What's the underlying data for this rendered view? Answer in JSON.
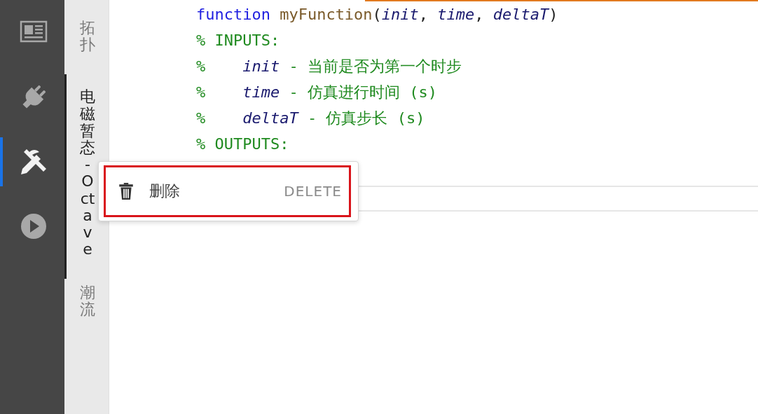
{
  "rail": {
    "items": [
      {
        "kind": "layout",
        "selected": false
      },
      {
        "kind": "plug",
        "selected": false
      },
      {
        "kind": "tools",
        "selected": true
      },
      {
        "kind": "play",
        "selected": false
      }
    ]
  },
  "tabs": [
    {
      "label": "拓扑",
      "selected": false
    },
    {
      "label": "电磁暂态 - Octave",
      "selected": true
    },
    {
      "label": "潮流",
      "selected": false
    }
  ],
  "code": {
    "lines": [
      {
        "tokens": [
          {
            "kind": "keyword",
            "text": "function"
          },
          {
            "kind": "name",
            "text": "myFunction"
          },
          {
            "kind": "plain",
            "text": "("
          },
          {
            "kind": "param",
            "text": "init"
          },
          {
            "kind": "plain",
            "text": ", "
          },
          {
            "kind": "param",
            "text": "time"
          },
          {
            "kind": "plain",
            "text": ", "
          },
          {
            "kind": "param",
            "text": "deltaT"
          },
          {
            "kind": "plain",
            "text": ")"
          }
        ]
      },
      {
        "tokens": [
          {
            "kind": "comment",
            "text": "% INPUTS:"
          }
        ]
      },
      {
        "tokens": [
          {
            "kind": "comment",
            "text": "%    "
          },
          {
            "kind": "param",
            "text": "init"
          },
          {
            "kind": "comment",
            "text": " - 当前是否为第一个时步"
          }
        ]
      },
      {
        "tokens": [
          {
            "kind": "comment",
            "text": "%    "
          },
          {
            "kind": "param",
            "text": "time"
          },
          {
            "kind": "comment",
            "text": " - 仿真进行时间 (s)"
          }
        ]
      },
      {
        "tokens": [
          {
            "kind": "comment",
            "text": "%    "
          },
          {
            "kind": "param",
            "text": "deltaT"
          },
          {
            "kind": "comment",
            "text": " - 仿真步长 (s)"
          }
        ]
      },
      {
        "tokens": [
          {
            "kind": "comment",
            "text": "% OUTPUTS:"
          }
        ]
      }
    ]
  },
  "context_menu": {
    "items": [
      {
        "label": "删除",
        "shortcut": "DELETE",
        "highlighted": true
      }
    ]
  }
}
